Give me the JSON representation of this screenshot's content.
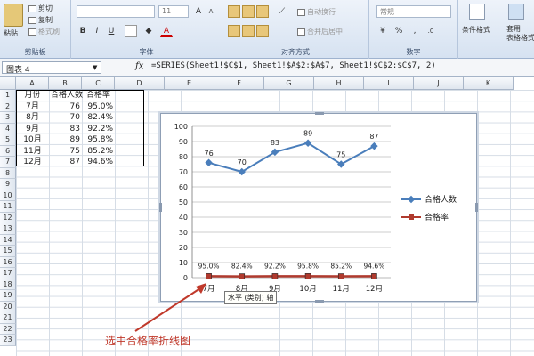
{
  "ribbon": {
    "clipboard": {
      "paste": "粘贴",
      "cut": "剪切",
      "copy": "复制",
      "format_painter": "格式刷",
      "label": "剪贴板"
    },
    "font": {
      "font_size": "11",
      "bold": "B",
      "italic": "I",
      "underline": "U",
      "grow": "A",
      "shrink": "A",
      "color": "A",
      "label": "字体"
    },
    "alignment": {
      "wrap": "自动换行",
      "merge": "合并后居中",
      "label": "对齐方式"
    },
    "number": {
      "format": "常规",
      "label": "数字"
    },
    "styles": {
      "conditional": "条件格式",
      "table": "套用\n表格格式"
    }
  },
  "formula_bar": {
    "name_box": "图表 4",
    "fx": "fx",
    "formula": "=SERIES(Sheet1!$C$1, Sheet1!$A$2:$A$7, Sheet1!$C$2:$C$7, 2)"
  },
  "columns": [
    "A",
    "B",
    "C",
    "D",
    "E",
    "F",
    "G",
    "H",
    "I",
    "J",
    "K"
  ],
  "rows": [
    "1",
    "2",
    "3",
    "4",
    "5",
    "6",
    "7",
    "8",
    "9",
    "10",
    "11",
    "12",
    "13",
    "14",
    "15",
    "16",
    "17",
    "18",
    "19",
    "20",
    "21",
    "22",
    "23"
  ],
  "table": {
    "headers": [
      "月份",
      "合格人数",
      "合格率"
    ],
    "rows": [
      [
        "7月",
        "76",
        "95.0%"
      ],
      [
        "8月",
        "70",
        "82.4%"
      ],
      [
        "9月",
        "83",
        "92.2%"
      ],
      [
        "10月",
        "89",
        "95.8%"
      ],
      [
        "11月",
        "75",
        "85.2%"
      ],
      [
        "12月",
        "87",
        "94.6%"
      ]
    ]
  },
  "chart_data": {
    "type": "line",
    "categories": [
      "7月",
      "8月",
      "9月",
      "10月",
      "11月",
      "12月"
    ],
    "series": [
      {
        "name": "合格人数",
        "values": [
          76,
          70,
          83,
          89,
          75,
          87
        ],
        "color": "#4a7ebb",
        "labels": [
          "76",
          "70",
          "83",
          "89",
          "75",
          "87"
        ]
      },
      {
        "name": "合格率",
        "values": [
          0.95,
          0.824,
          0.922,
          0.958,
          0.852,
          0.946
        ],
        "color": "#b03a2e",
        "labels": [
          "95.0%",
          "82.4%",
          "92.2%",
          "95.8%",
          "85.2%",
          "94.6%"
        ]
      }
    ],
    "ylim": [
      0,
      100
    ],
    "yticks": [
      "0",
      "10",
      "20",
      "30",
      "40",
      "50",
      "60",
      "70",
      "80",
      "90",
      "100"
    ],
    "grid": true,
    "legend_position": "right"
  },
  "tooltip": "水平 (类别) 轴",
  "annotation": "选中合格率折线图"
}
